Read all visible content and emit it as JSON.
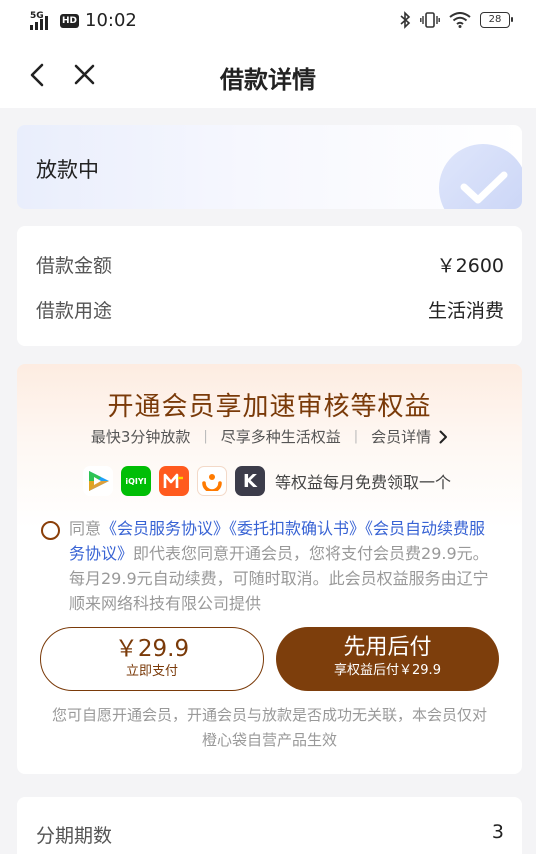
{
  "status_bar": {
    "network": "5G",
    "hd": "HD",
    "time": "10:02",
    "battery": "28"
  },
  "header": {
    "title": "借款详情"
  },
  "loan_status": {
    "text": "放款中"
  },
  "loan_info": {
    "rows": [
      {
        "label": "借款金额",
        "value": "￥2600"
      },
      {
        "label": "借款用途",
        "value": "生活消费"
      }
    ]
  },
  "membership": {
    "title": "开通会员享加速审核等权益",
    "benefits": [
      "最快3分钟放款",
      "尽享多种生活权益"
    ],
    "details_link": "会员详情",
    "apps": [
      {
        "icon": "tencent-video-icon",
        "label": ""
      },
      {
        "icon": "iqiyi-icon",
        "label": "iQIYI"
      },
      {
        "icon": "mango-tv-icon",
        "label": ""
      },
      {
        "icon": "didi-icon",
        "label": ""
      },
      {
        "icon": "keep-icon",
        "label": "K"
      }
    ],
    "apps_text": "等权益每月免费领取一个",
    "agreement": {
      "prefix": "同意",
      "link1": "《会员服务协议》",
      "link2": "《委托扣款确认书》",
      "link3": "《会员自动续费服务协议》",
      "body": "即代表您同意开通会员，您将支付会员费29.9元。每月29.9元自动续费，可随时取消。此会员权益服务由辽宁顺来网络科技有限公司提供"
    },
    "pay_now": {
      "price": "￥29.9",
      "label": "立即支付"
    },
    "pay_later": {
      "label": "先用后付",
      "sub": "享权益后付￥29.9"
    },
    "disclaimer": "您可自愿开通会员，开通会员与放款是否成功无关联，本会员仅对橙心袋自营产品生效"
  },
  "installments": {
    "label": "分期期数",
    "value": "3"
  },
  "colors": {
    "brand_brown": "#7d3e0c",
    "link_blue": "#3863d4",
    "page_bg": "#f4f4f6"
  }
}
